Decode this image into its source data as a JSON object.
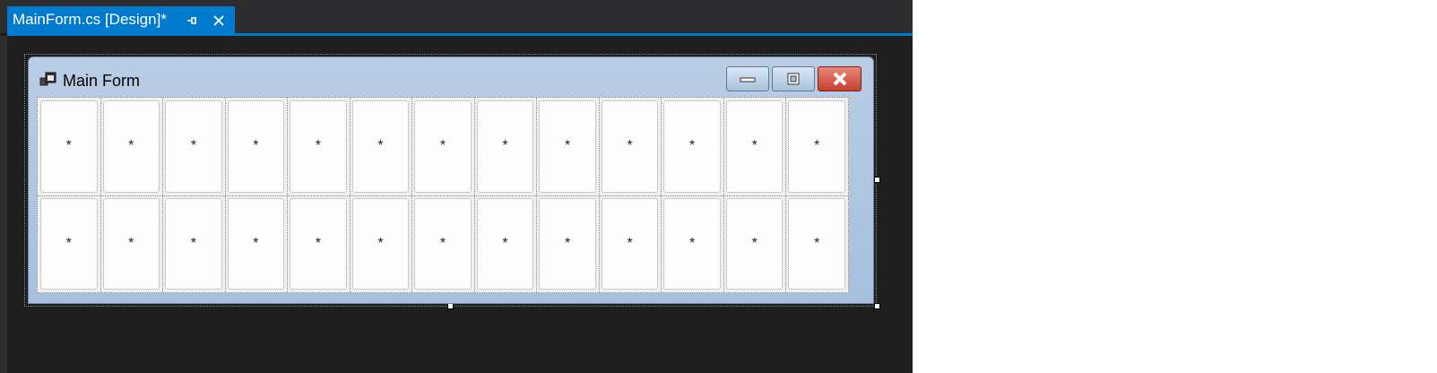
{
  "tab": {
    "title": "MainForm.cs [Design]*",
    "pin_icon": "pin-icon",
    "close_icon": "close-icon"
  },
  "form": {
    "title": "Main Form",
    "icon": "form-window-icon",
    "caption_buttons": [
      "minimize",
      "maximize",
      "close"
    ]
  },
  "grid": {
    "rows": [
      [
        "*",
        "*",
        "*",
        "*",
        "*",
        "*",
        "*",
        "*",
        "*",
        "*",
        "*",
        "*",
        "*"
      ],
      [
        "*",
        "*",
        "*",
        "*",
        "*",
        "*",
        "*",
        "*",
        "*",
        "*",
        "*",
        "*",
        "*"
      ]
    ]
  },
  "colors": {
    "accent": "#007acc",
    "ide_background": "#1e1e1e",
    "tabstrip": "#2d2d30"
  }
}
